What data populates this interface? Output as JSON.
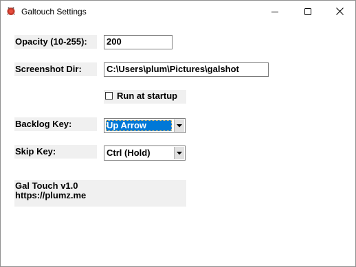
{
  "window": {
    "title": "Galtouch Settings"
  },
  "titlebar_buttons": {
    "minimize_icon": "minimize-icon",
    "maximize_icon": "maximize-icon",
    "close_icon": "close-icon"
  },
  "settings": {
    "opacity": {
      "label": "Opacity (10-255):",
      "value": "200"
    },
    "screenshot_dir": {
      "label": "Screenshot Dir:",
      "value": "C:\\Users\\plum\\Pictures\\galshot"
    },
    "run_at_startup": {
      "label": "Run at startup",
      "checked": false
    },
    "backlog_key": {
      "label": "Backlog Key:",
      "value": "Up Arrow"
    },
    "skip_key": {
      "label": "Skip Key:",
      "value": "Ctrl (Hold)"
    }
  },
  "about": {
    "version": "Gal Touch v1.0",
    "url": "https://plumz.me"
  },
  "colors": {
    "selection": "#0078d7",
    "panel_bg": "#f0f0f0",
    "window_bg": "#ffffff"
  }
}
